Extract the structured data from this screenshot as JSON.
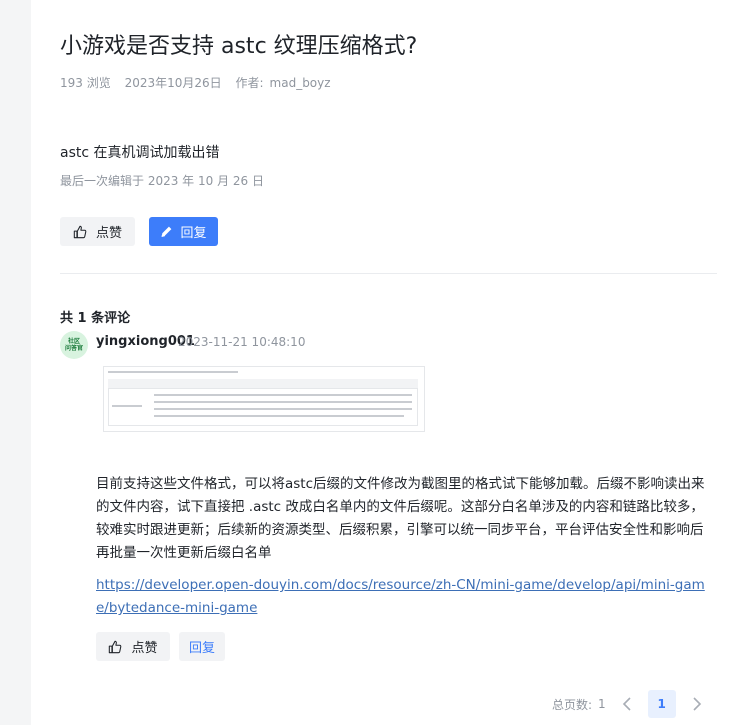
{
  "post": {
    "title": "小游戏是否支持 astc 纹理压缩格式?",
    "views": "193 浏览",
    "date": "2023年10月26日",
    "author_label": "作者:",
    "author": "mad_boyz",
    "body": "astc 在真机调试加载出错",
    "edited": "最后一次编辑于 2023 年 10 月 26 日",
    "like_label": "点赞",
    "reply_label": "回复"
  },
  "comments": {
    "count_label": "共 1 条评论",
    "items": [
      {
        "avatar_text_line1": "社区",
        "avatar_text_line2": "问答官",
        "author": "yingxiong001",
        "time": "2023-11-21 10:48:10",
        "text": "目前支持这些文件格式，可以将astc后缀的文件修改为截图里的格式试下能够加载。后缀不影响读出来的文件内容，试下直接把 .astc 改成白名单内的文件后缀呢。这部分白名单涉及的内容和链路比较多，较难实时跟进更新；后续新的资源类型、后缀积累，引擎可以统一同步平台，平台评估安全性和影响后再批量一次性更新后缀白名单",
        "link": "https://developer.open-douyin.com/docs/resource/zh-CN/mini-game/develop/api/mini-game/bytedance-mini-game",
        "like_label": "点赞",
        "reply_label": "回复"
      }
    ]
  },
  "pagination": {
    "total_label": "总页数:",
    "total": "1",
    "current": "1"
  },
  "colors": {
    "accent": "#3d7dfa",
    "link": "#3d6fb6",
    "muted": "#8f959e"
  },
  "icons": {
    "like": "thumbs-up-icon",
    "reply": "pencil-icon",
    "prev": "chevron-left-icon",
    "next": "chevron-right-icon"
  }
}
